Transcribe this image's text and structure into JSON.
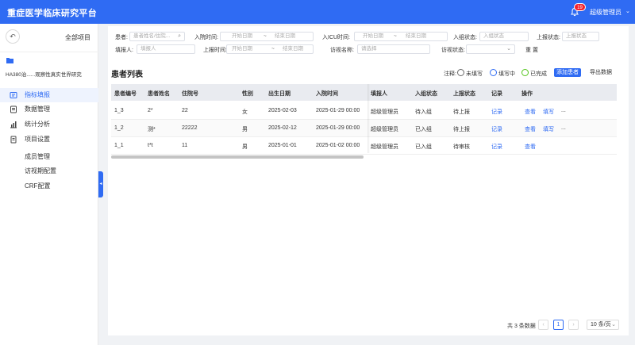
{
  "app": {
    "title": "重症医学临床研究平台",
    "notification_count": "19",
    "user": "超级管理员"
  },
  "sidebar": {
    "all_projects": "全部项目",
    "project_name": "HA380治......观察性真实世界研究",
    "menu": [
      {
        "label": "指标填报"
      },
      {
        "label": "数据管理"
      },
      {
        "label": "统计分析"
      },
      {
        "label": "项目设置"
      }
    ],
    "sub_menu": [
      {
        "label": "成员管理"
      },
      {
        "label": "访视期配置"
      },
      {
        "label": "CRF配置"
      }
    ]
  },
  "filters": {
    "patient_label": "患者:",
    "patient_placeholder": "患者姓名/住院...",
    "admit_label": "入院时间:",
    "icu_label": "入ICU时间:",
    "start_placeholder": "开始日期",
    "end_placeholder": "结束日期",
    "range_sep": "~",
    "enroll_label": "入组状态:",
    "enroll_placeholder": "入组状态",
    "report_label": "上报状态:",
    "report_placeholder": "上报状态",
    "filler_label": "填报人:",
    "filler_placeholder": "填报人",
    "report_time_label": "上报时间:",
    "visit_label": "访视名称:",
    "visit_placeholder": "请选择",
    "visit_status_label": "访视状态:",
    "reset": "重 置"
  },
  "list": {
    "title": "患者列表",
    "note": "注释:",
    "legend": [
      "未填写",
      "填写中",
      "已完成"
    ],
    "add_button": "添加患者",
    "export_button": "导出数据"
  },
  "table": {
    "headers": [
      "患者编号",
      "患者姓名",
      "住院号",
      "性别",
      "出生日期",
      "入院时间",
      "填报人",
      "入组状态",
      "上报状态",
      "记录",
      "操作"
    ],
    "rows": [
      {
        "id": "1_3",
        "name": "2*",
        "hospital_no": "22",
        "gender": "女",
        "birth": "2025-02-03",
        "admit": "2025-01-29 00:00",
        "filler": "超级管理员",
        "enroll": "待入组",
        "report": "待上报",
        "record": "记录",
        "actions": [
          "查看",
          "填写",
          "..."
        ]
      },
      {
        "id": "1_2",
        "name": "测*",
        "hospital_no": "22222",
        "gender": "男",
        "birth": "2025-02-12",
        "admit": "2025-01-29 00:00",
        "filler": "超级管理员",
        "enroll": "已入组",
        "report": "待上报",
        "record": "记录",
        "actions": [
          "查看",
          "填写",
          "..."
        ]
      },
      {
        "id": "1_1",
        "name": "t*t",
        "hospital_no": "11",
        "gender": "男",
        "birth": "2025-01-01",
        "admit": "2025-01-02 00:00",
        "filler": "超级管理员",
        "enroll": "已入组",
        "report": "待审核",
        "record": "记录",
        "actions": [
          "查看"
        ]
      }
    ]
  },
  "pagination": {
    "total": "共 3 条数据",
    "current": "1",
    "page_size": "10 条/页",
    "prev": "‹",
    "next": "›"
  }
}
